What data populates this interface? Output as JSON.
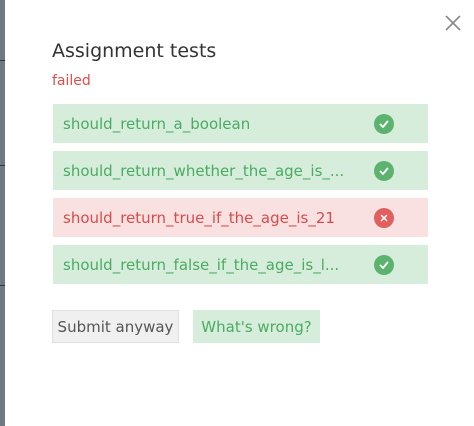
{
  "modal": {
    "title": "Assignment tests",
    "status": "failed",
    "close_icon": "close-icon"
  },
  "tests": [
    {
      "name": "should_return_a_boolean",
      "result": "pass",
      "icon": "check-icon"
    },
    {
      "name": "should_return_whether_the_age_is_...",
      "result": "pass",
      "icon": "check-icon"
    },
    {
      "name": "should_return_true_if_the_age_is_21",
      "result": "fail",
      "icon": "x-icon"
    },
    {
      "name": "should_return_false_if_the_age_is_l...",
      "result": "pass",
      "icon": "check-icon"
    }
  ],
  "actions": {
    "submit_label": "Submit anyway",
    "help_label": "What's wrong?"
  },
  "colors": {
    "pass_bg": "#d7eddb",
    "pass_text": "#4aab62",
    "fail_bg": "#f9e1e1",
    "fail_text": "#d94b4b",
    "status_failed": "#e04d4d"
  }
}
